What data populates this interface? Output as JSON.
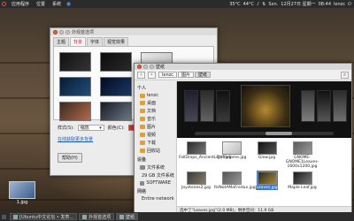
{
  "top_panel": {
    "menus": [
      "应用程序",
      "位置",
      "系统"
    ],
    "status": [
      "35°C",
      "44°C",
      "Sxn.",
      "12月27日 星期一",
      "08:44",
      "lenzc"
    ]
  },
  "bottom_panel": {
    "tasks": [
      "[Ubuntu中文论坛 • 发表...",
      "外观首选项",
      "壁纸"
    ]
  },
  "desktop_icon": {
    "label": "1.jpg"
  },
  "appearance": {
    "title": "外观首选项",
    "tabs": [
      "主题",
      "背景",
      "字体",
      "视觉效果"
    ],
    "active_tab": 1,
    "style_label": "样式(S):",
    "style_value": "缩放",
    "color_label": "颜色(C):",
    "link": "在线获取更多背景",
    "help": "帮助(H)",
    "wallpapers": [
      {
        "c1": "#111",
        "c2": "#333"
      },
      {
        "c1": "#0b0b0b",
        "c2": "#2a2a2a"
      },
      {
        "c1": "#e8e8e8",
        "c2": "#c2c2c2"
      },
      {
        "c1": "#0a1a33",
        "c2": "#1f4f7a"
      },
      {
        "c1": "#020a1f",
        "c2": "#1a3a66"
      },
      {
        "c1": "#1a2433",
        "c2": "#5e7690"
      },
      {
        "c1": "#3a2a22",
        "c2": "#b36a4a"
      },
      {
        "c1": "#1a1a22",
        "c2": "#6b7a88"
      },
      {
        "c1": "#222",
        "c2": "#555"
      }
    ]
  },
  "file_manager": {
    "title": "壁纸",
    "crumbs": [
      "lenzc",
      "图片",
      "壁纸"
    ],
    "active_crumb": 2,
    "sidebar": {
      "places_header": "个人",
      "places": [
        "lenzc",
        "桌面",
        "文档",
        "音乐",
        "图片",
        "视频",
        "下载",
        "回收站"
      ],
      "devices_header": "设备",
      "devices": [
        "文件系统",
        "29 GB 文件系统",
        "SOFTWARE"
      ],
      "network_header": "网络",
      "network": [
        "Entire network"
      ]
    },
    "files": [
      {
        "name": "FallDrops_AncientLight.jpg",
        "c1": "#2b2b2b",
        "c2": "#777"
      },
      {
        "name": "Fluffodome.jpg",
        "c1": "#f0f0f0",
        "c2": "#bbb"
      },
      {
        "name": "Glow.jpg",
        "c1": "#111",
        "c2": "#555"
      },
      {
        "name": "GNOME-GNOME1Leaves-1600x1200.jpg",
        "c1": "#5c5c5c",
        "c2": "#9a9a9a"
      },
      {
        "name": "",
        "c1": "#fff",
        "c2": "#fff"
      },
      {
        "name": "Joystones2.jpg",
        "c1": "#3a3a3a",
        "c2": "#8a7d6a"
      },
      {
        "name": "ItsNotAMaFredux.jpg",
        "c1": "#555",
        "c2": "#999"
      },
      {
        "name": "Leaves.jpg",
        "c1": "#2b2a20",
        "c2": "#a48a3a"
      },
      {
        "name": "Maple Leaf.jpg",
        "c1": "#1a1a1a",
        "c2": "#777"
      },
      {
        "name": "",
        "c1": "#fff",
        "c2": "#fff"
      }
    ],
    "selected_file": 7,
    "status": "选中了“Leaves.jpg”(2.0 MB)，剩余空间：11.9 GB"
  }
}
